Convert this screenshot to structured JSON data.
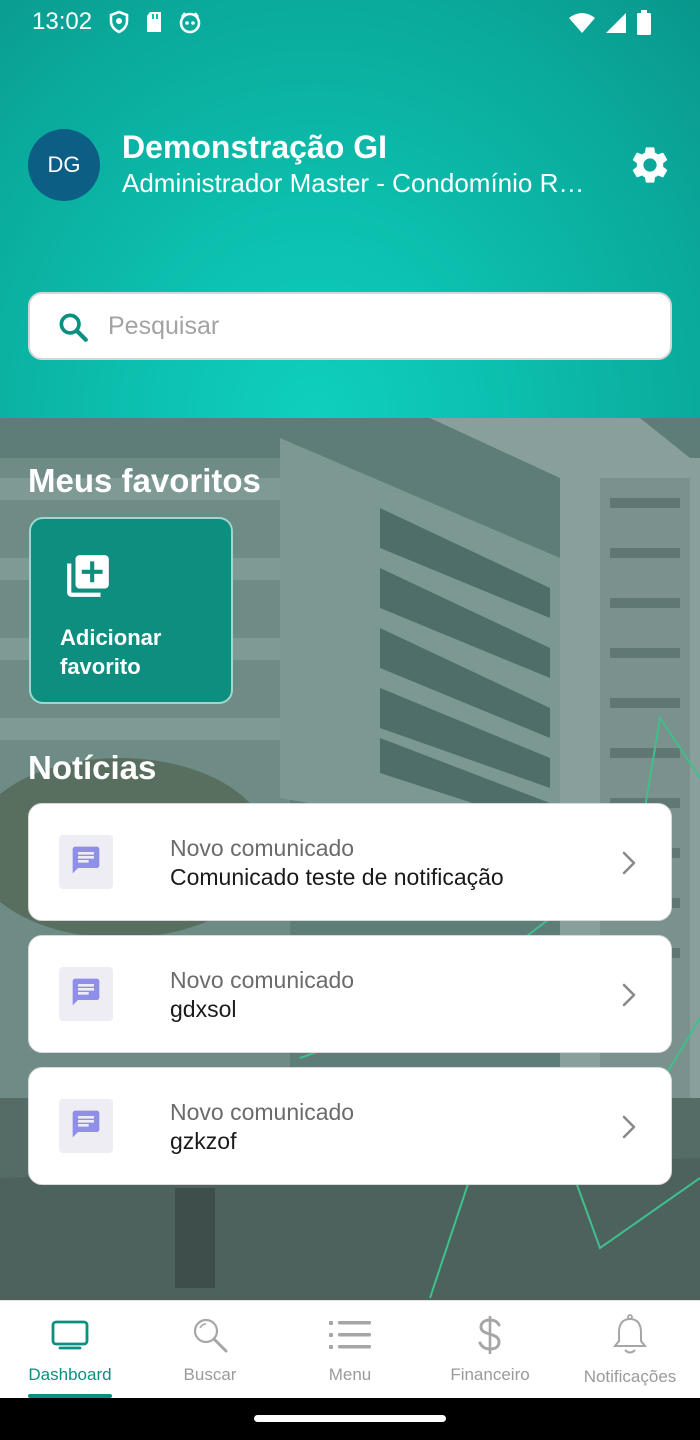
{
  "status": {
    "time": "13:02",
    "left_icons": [
      "shield-icon",
      "sd-card-icon",
      "android-face-icon"
    ],
    "right_icons": [
      "wifi-icon",
      "signal-icon",
      "battery-icon"
    ]
  },
  "profile": {
    "initials": "DG",
    "name": "Demonstração GI",
    "role": "Administrador Master - Condomínio Residencial",
    "avatar_color": "#0c5e84"
  },
  "search": {
    "placeholder": "Pesquisar",
    "value": ""
  },
  "favorites": {
    "title": "Meus favoritos",
    "add_label": "Adicionar favorito",
    "card_color": "#0e8e7f"
  },
  "news": {
    "title": "Notícias",
    "items": [
      {
        "type": "Novo comunicado",
        "title": "Comunicado teste de notificação"
      },
      {
        "type": "Novo comunicado",
        "title": "gdxsol"
      },
      {
        "type": "Novo comunicado",
        "title": "gzkzof"
      }
    ]
  },
  "tabs": [
    {
      "label": "Dashboard",
      "icon": "monitor-icon",
      "active": true
    },
    {
      "label": "Buscar",
      "icon": "search-icon",
      "active": false
    },
    {
      "label": "Menu",
      "icon": "menu-list-icon",
      "active": false
    },
    {
      "label": "Financeiro",
      "icon": "dollar-icon",
      "active": false
    },
    {
      "label": "Notificações",
      "icon": "bell-icon",
      "active": false
    }
  ],
  "colors": {
    "accent": "#0b8f80",
    "header": "#0cbfae"
  }
}
